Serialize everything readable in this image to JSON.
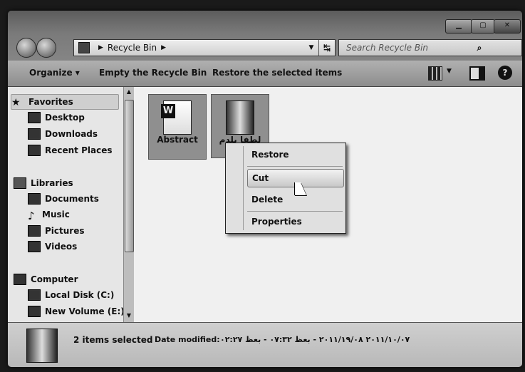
{
  "window": {
    "address": {
      "crumb": "Recycle Bin"
    },
    "search": {
      "placeholder": "Search Recycle Bin"
    }
  },
  "toolbar": {
    "organize": "Organize",
    "empty": "Empty the Recycle Bin",
    "restore_all": "Restore the selected items"
  },
  "nav": {
    "favorites": "Favorites",
    "desktop": "Desktop",
    "downloads": "Downloads",
    "recent": "Recent Places",
    "libraries": "Libraries",
    "documents": "Documents",
    "music": "Music",
    "pictures": "Pictures",
    "videos": "Videos",
    "computer": "Computer",
    "local_disk": "Local Disk (C:)",
    "new_volume": "New Volume (E:)"
  },
  "files": [
    {
      "label": "Abstract",
      "icon": "word-document-icon"
    },
    {
      "label": "لطفا بلدم",
      "icon": "folder-icon"
    }
  ],
  "context_menu": {
    "restore": "Restore",
    "cut": "Cut",
    "delete": "Delete",
    "properties": "Properties"
  },
  "details": {
    "count": "2 items selected",
    "date_label": "Date modified:",
    "date_value": "۲۰۱۱/۱۰/۰۷ ۲۰۱۱/۱۹/۰۸ - بعظ ۰۷:۳۲ - بعظ ۰۲:۲۷"
  }
}
